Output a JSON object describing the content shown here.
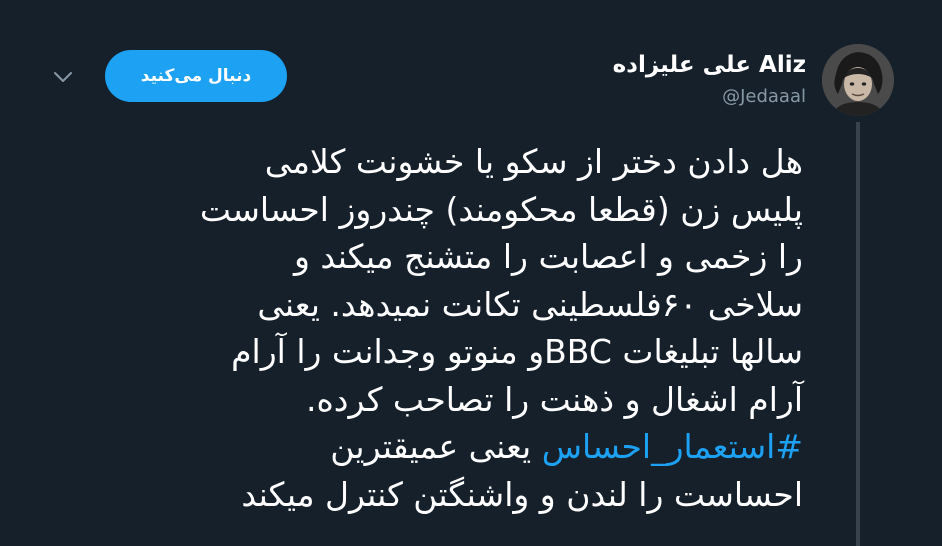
{
  "user": {
    "display_name": "Aliz علی علیزاده",
    "handle": "@Jedaaal",
    "avatar_icon": "person-avatar"
  },
  "actions": {
    "follow_label": "دنبال می‌کنید",
    "menu_icon": "chevron-down-icon"
  },
  "tweet": {
    "lines": [
      "هل دادن دختر از سکو یا خشونت کلامی",
      "پلیس زن (قطعا محکومند) چندروز احساست",
      "را زخمی و اعصابت را متشنج میکند و",
      "سلاخی ۶۰فلسطینی تکانت نمیدهد. یعنی",
      "سالها تبلیغات BBCو منوتو وجدانت را آرام",
      "آرام اشغال و ذهنت را تصاحب کرده.",
      "یعنی عمیقترین",
      "احساست را لندن و واشنگتن کنترل میکند"
    ],
    "hashtag": "#استعمار_احساس"
  },
  "colors": {
    "background": "#15202b",
    "accent": "#1da1f2",
    "text": "#ffffff",
    "muted": "#8899a6"
  }
}
